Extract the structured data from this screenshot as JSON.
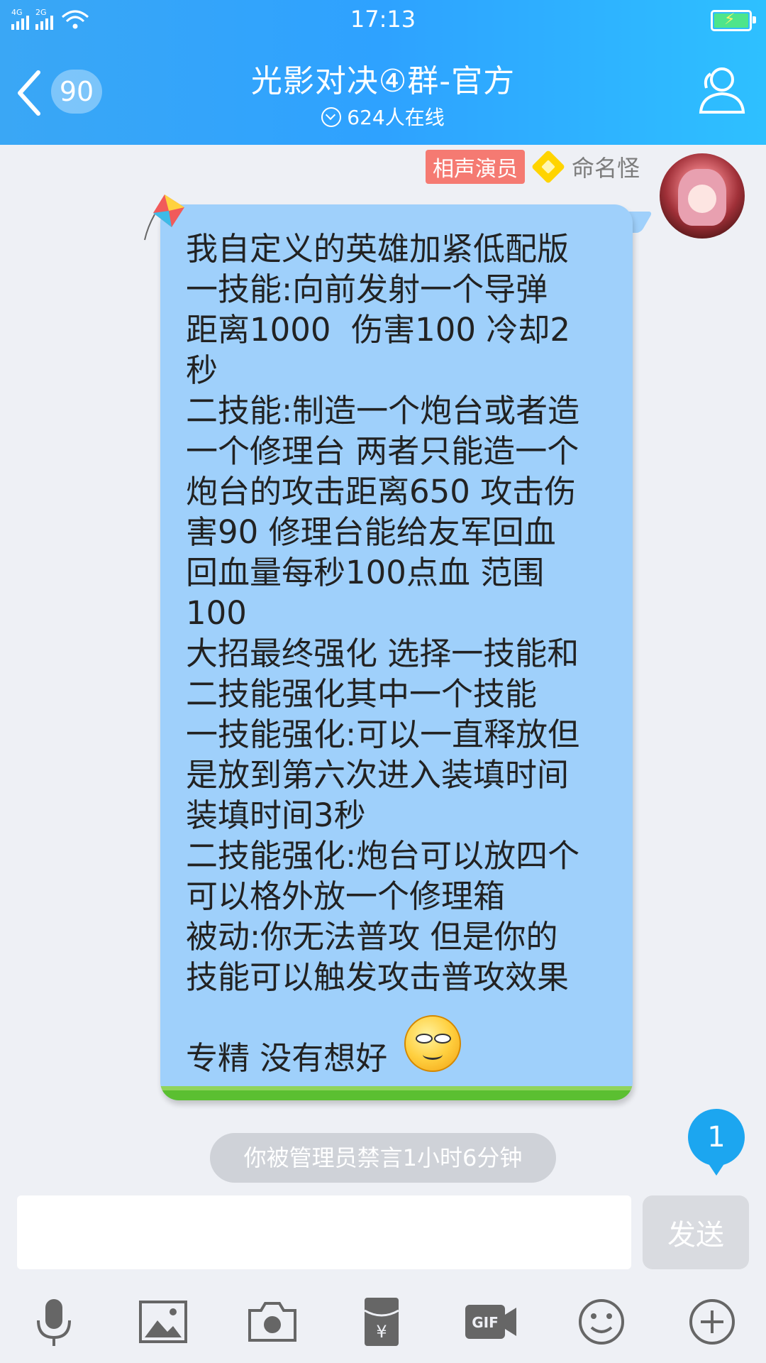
{
  "status_bar": {
    "time": "17:13",
    "net1": "4G",
    "net2": "2G"
  },
  "header": {
    "back_count": "90",
    "title": "光影对决④群-官方",
    "subtitle": "624人在线"
  },
  "message": {
    "role_badge": "相声演员",
    "sender": "命名怪",
    "text": "我自定义的英雄加紧低配版\n一技能:向前发射一个导弹\n距离1000  伤害100 冷却2\n秒\n二技能:制造一个炮台或者造\n一个修理台 两者只能造一个\n炮台的攻击距离650 攻击伤\n害90 修理台能给友军回血\n回血量每秒100点血 范围\n100\n大招最终强化 选择一技能和\n二技能强化其中一个技能\n一技能强化:可以一直释放但\n是放到第六次进入装填时间\n装填时间3秒\n二技能强化:炮台可以放四个\n可以格外放一个修理箱\n被动:你无法普攻 但是你的\n技能可以触发攻击普攻效果\n\n专精 没有想好"
  },
  "notice": {
    "new_count": "1",
    "mute_text": "你被管理员禁言1小时6分钟"
  },
  "composer": {
    "input_value": "",
    "send_label": "发送"
  },
  "toolbar": {
    "items": [
      "mic-icon",
      "image-icon",
      "camera-icon",
      "red-packet-icon",
      "gif-icon",
      "emoji-icon",
      "plus-icon"
    ]
  },
  "colors": {
    "header": "#2ea2ff",
    "bubble": "#9fd0fb",
    "badge": "#f57a72",
    "send_disabled": "#d9dbe0"
  }
}
